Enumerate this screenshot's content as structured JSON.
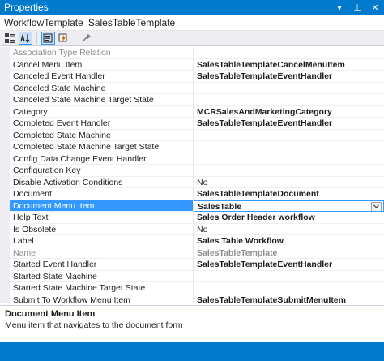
{
  "window": {
    "title": "Properties",
    "buttons": [
      {
        "name": "dropdown-icon",
        "glyph": "▾"
      },
      {
        "name": "pin-icon",
        "glyph": "⊥"
      },
      {
        "name": "close-icon",
        "glyph": "✕"
      }
    ]
  },
  "object": {
    "name": "WorkflowTemplate",
    "type": "SalesTableTemplate"
  },
  "toolbar": {
    "icons": [
      "categorized-icon",
      "alphabetical-icon",
      "properties-icon",
      "events-icon",
      "property-pages-icon"
    ]
  },
  "properties": [
    {
      "name": "Association Type Relation",
      "value": "",
      "bold": false,
      "disabled": true
    },
    {
      "name": "Cancel Menu Item",
      "value": "SalesTableTemplateCancelMenuItem",
      "bold": true
    },
    {
      "name": "Canceled Event Handler",
      "value": "SalesTableTemplateEventHandler",
      "bold": true
    },
    {
      "name": "Canceled State Machine",
      "value": "",
      "bold": false
    },
    {
      "name": "Canceled State Machine Target State",
      "value": "",
      "bold": false
    },
    {
      "name": "Category",
      "value": "MCRSalesAndMarketingCategory",
      "bold": true
    },
    {
      "name": "Completed Event Handler",
      "value": "SalesTableTemplateEventHandler",
      "bold": true
    },
    {
      "name": "Completed State Machine",
      "value": "",
      "bold": false
    },
    {
      "name": "Completed State Machine Target State",
      "value": "",
      "bold": false
    },
    {
      "name": "Config Data Change Event Handler",
      "value": "",
      "bold": false
    },
    {
      "name": "Configuration Key",
      "value": "",
      "bold": false
    },
    {
      "name": "Disable Activation Conditions",
      "value": "No",
      "bold": false
    },
    {
      "name": "Document",
      "value": "SalesTableTemplateDocument",
      "bold": true
    },
    {
      "name": "Document Menu Item",
      "value": "SalesTable",
      "bold": true,
      "selected": true
    },
    {
      "name": "Help Text",
      "value": "Sales Order Header workflow",
      "bold": true
    },
    {
      "name": "Is Obsolete",
      "value": "No",
      "bold": false
    },
    {
      "name": "Label",
      "value": "Sales Table Workflow",
      "bold": true
    },
    {
      "name": "Name",
      "value": "SalesTableTemplate",
      "bold": true,
      "disabled": true
    },
    {
      "name": "Started Event Handler",
      "value": "SalesTableTemplateEventHandler",
      "bold": true
    },
    {
      "name": "Started State Machine",
      "value": "",
      "bold": false
    },
    {
      "name": "Started State Machine Target State",
      "value": "",
      "bold": false
    },
    {
      "name": "Submit To Workflow Menu Item",
      "value": "SalesTableTemplateSubmitMenuItem",
      "bold": true
    }
  ],
  "description": {
    "title": "Document Menu Item",
    "text": "Menu item that navigates to the document form"
  },
  "colors": {
    "accent": "#007acc",
    "selection": "#3399ff"
  }
}
